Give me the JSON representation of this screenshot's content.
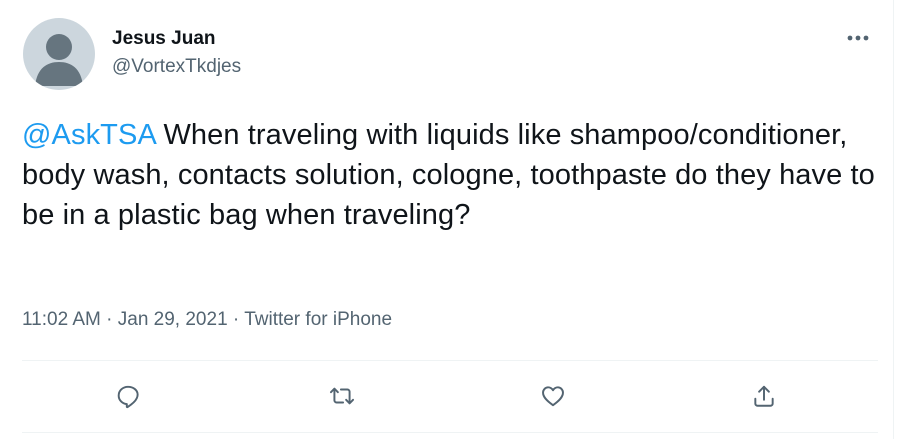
{
  "author": {
    "name": "Jesus Juan",
    "handle": "@VortexTkdjes"
  },
  "tweet": {
    "mention": "@AskTSA",
    "body": " When traveling with liquids like shampoo/conditioner, body wash, contacts solution, cologne, toothpaste do they have to be in a plastic bag when traveling?"
  },
  "meta": {
    "time": "11:02 AM",
    "separator": " · ",
    "date": "Jan 29, 2021",
    "source": "Twitter for iPhone"
  },
  "icons": {
    "more": "more-horizontal-icon",
    "reply": "reply-icon",
    "retweet": "retweet-icon",
    "like": "like-icon",
    "share": "share-icon"
  },
  "colors": {
    "accent": "#1d9bf0",
    "text": "#0f1419",
    "secondary": "#536471",
    "avatar_bg": "#ccd6dd"
  }
}
